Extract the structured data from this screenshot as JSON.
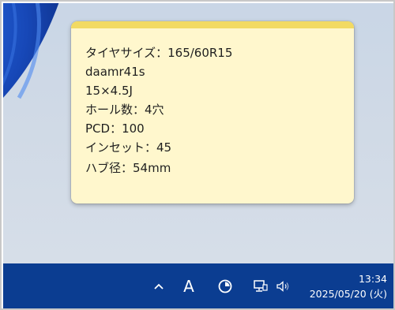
{
  "sticky_note": {
    "lines": [
      "タイヤサイズ：165/60R15",
      "daamr41s",
      "15×4.5J",
      "ホール数：4穴",
      "PCD：100",
      "インセット：45",
      "ハブ径：54mm"
    ],
    "colors": {
      "header": "#f2da63",
      "body": "#fff7cd"
    }
  },
  "taskbar": {
    "background": "#0b3d91",
    "tray": {
      "overflow_icon": "chevron-up-icon",
      "ime_indicator": "A",
      "focus_icon": "focus-clock-icon",
      "network_icon": "network-icon",
      "volume_icon": "volume-icon"
    },
    "clock": {
      "time": "13:34",
      "date": "2025/05/20 (火)"
    }
  }
}
